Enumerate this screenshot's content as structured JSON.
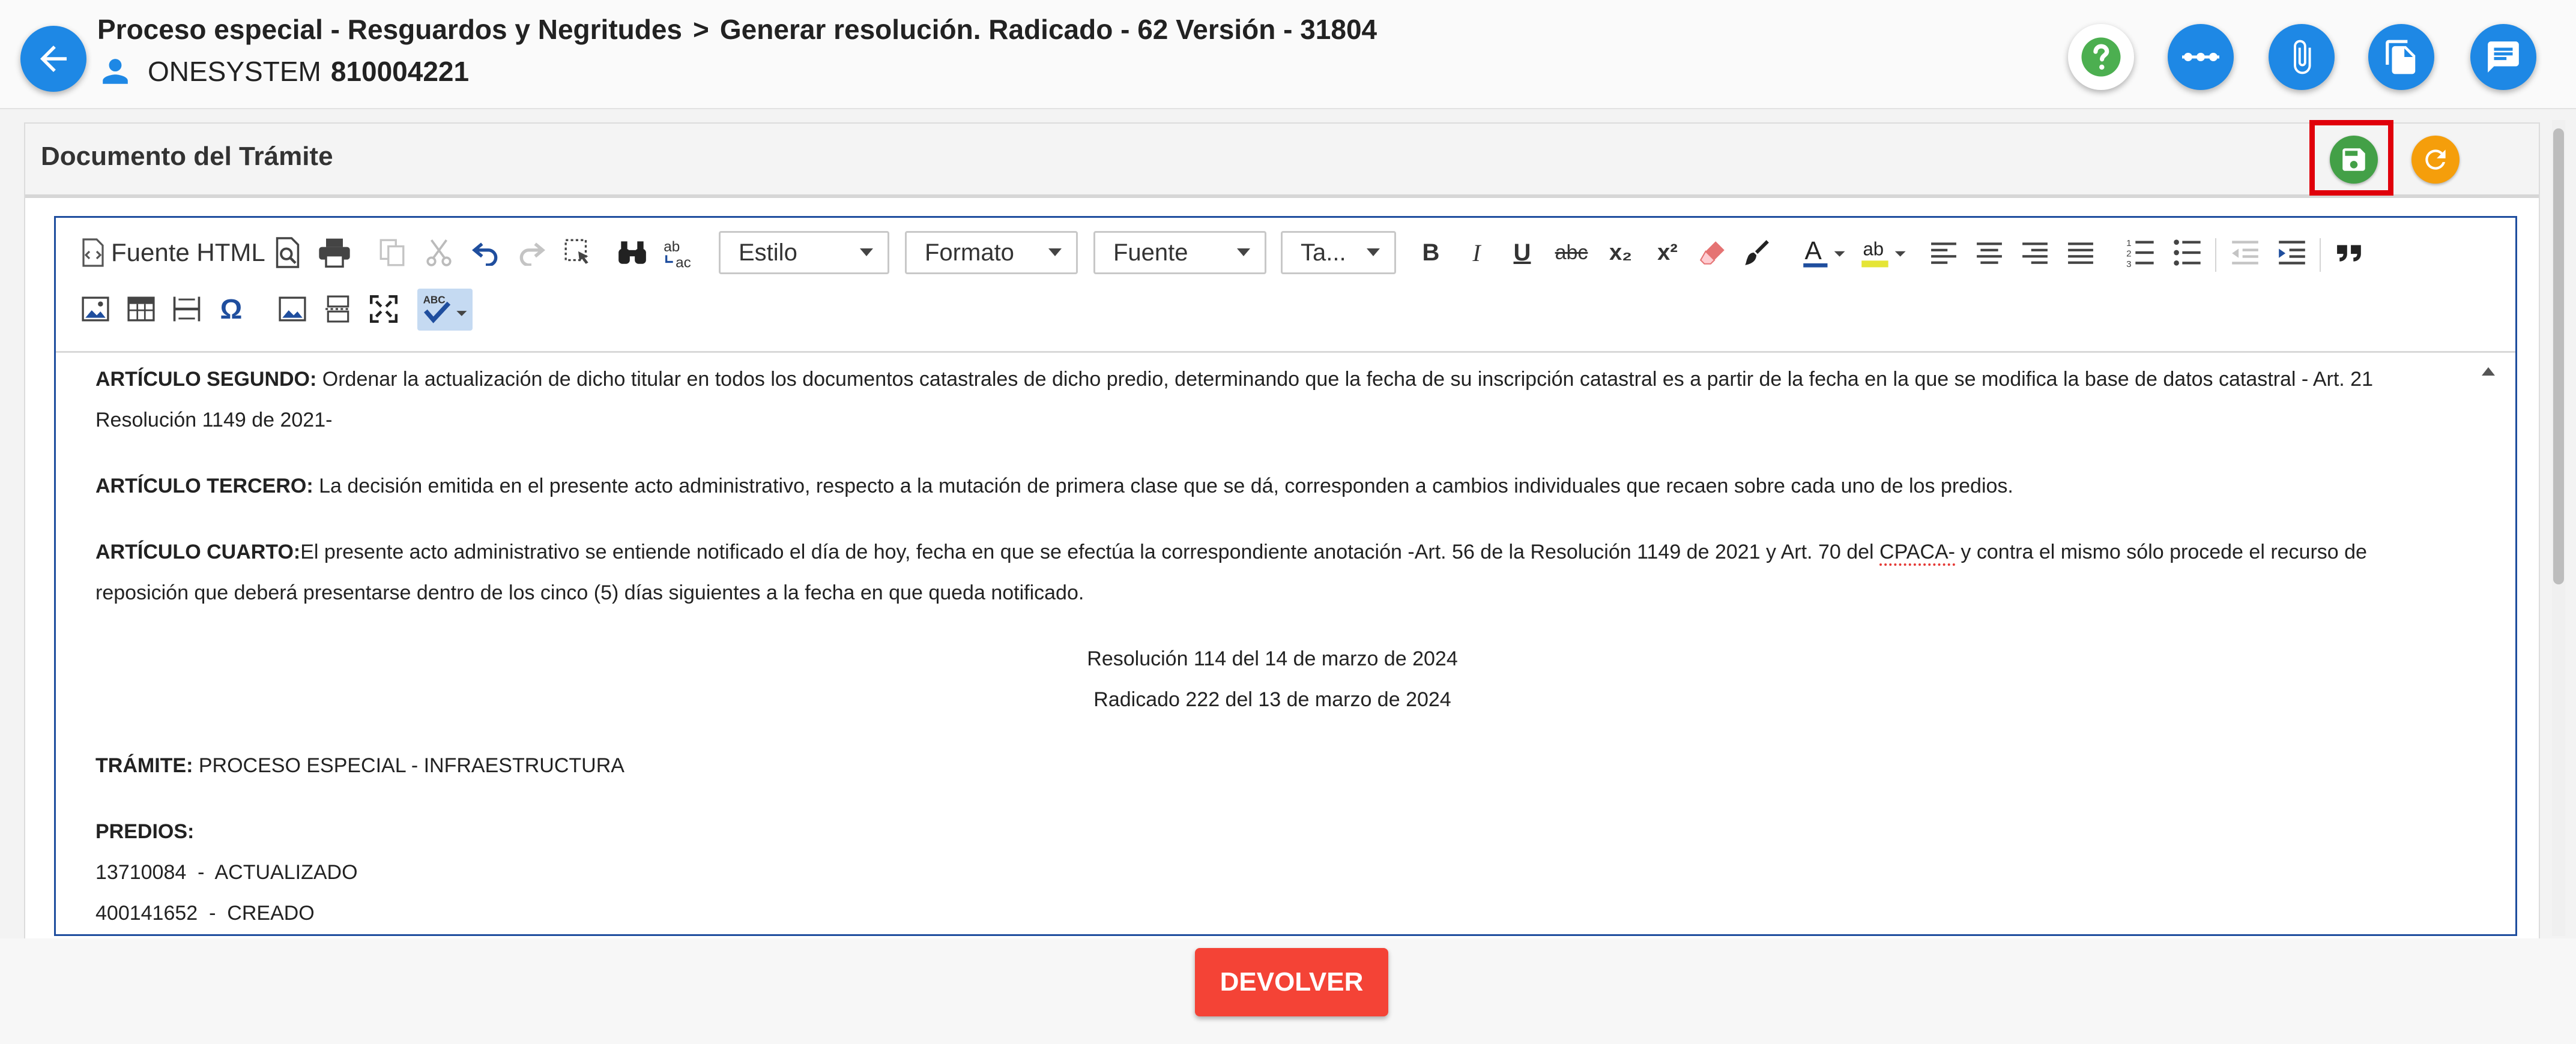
{
  "header": {
    "process": "Proceso especial - Resguardos y Negritudes",
    "separator": ">",
    "task": "Generar resolución. Radicado - 62 Versión - 31804",
    "user_name": "ONESYSTEM",
    "user_id": "810004221"
  },
  "panel": {
    "title": "Documento del Trámite"
  },
  "toolbar": {
    "source_label": "Fuente HTML",
    "style_combo": "Estilo",
    "format_combo": "Formato",
    "font_combo": "Fuente",
    "size_combo": "Ta...",
    "bold": "B",
    "italic": "I",
    "underline": "U",
    "strike": "abc",
    "subscript": "x₂",
    "superscript": "x²",
    "special_char": "Ω",
    "spell_label": "ABC"
  },
  "document": {
    "art2_label": "ARTÍCULO SEGUNDO:",
    "art2_text": " Ordenar la actualización de dicho titular en todos los documentos catastrales de dicho predio, determinando que la fecha de su inscripción catastral es a partir de la fecha en la que se modifica la base de datos catastral - Art. 21 Resolución 1149 de 2021-",
    "art3_label": "ARTÍCULO TERCERO:",
    "art3_text": " La decisión emitida en el presente acto administrativo, respecto a la mutación de primera clase que se dá, corresponden a cambios individuales que recaen sobre cada uno de los predios.",
    "art4_label": "ARTÍCULO CUARTO:",
    "art4_text_a": "El presente acto administrativo se entiende notificado el día de hoy, fecha en que se efectúa la correspondiente anotación -Art. 56 de la Resolución 1149 de 2021 y Art. 70 del ",
    "art4_spell": "CPACA-",
    "art4_text_b": " y contra el mismo sólo procede el recurso de reposición que deberá presentarse dentro de los cinco (5) días siguientes a la fecha en que queda notificado.",
    "resolution_line": "Resolución 114 del 14 de marzo de 2024",
    "radicado_line": "Radicado 222 del 13 de marzo de 2024",
    "tramite_label": "TRÁMITE:",
    "tramite_value": " PROCESO ESPECIAL - INFRAESTRUCTURA",
    "predios_label": "PREDIOS:",
    "predios": [
      "13710084  -  ACTUALIZADO",
      "400141652  -  CREADO"
    ]
  },
  "actions": {
    "return_label": "DEVOLVER"
  },
  "colors": {
    "primary": "#1e88e5",
    "save": "#43a047",
    "reload": "#f59e0b",
    "danger": "#f44336",
    "highlight_frame": "#e0000b"
  },
  "icons": [
    "back-arrow-icon",
    "user-icon",
    "help-icon",
    "more-icon",
    "attachment-icon",
    "copy-docs-icon",
    "comments-icon",
    "save-icon",
    "reload-icon"
  ]
}
